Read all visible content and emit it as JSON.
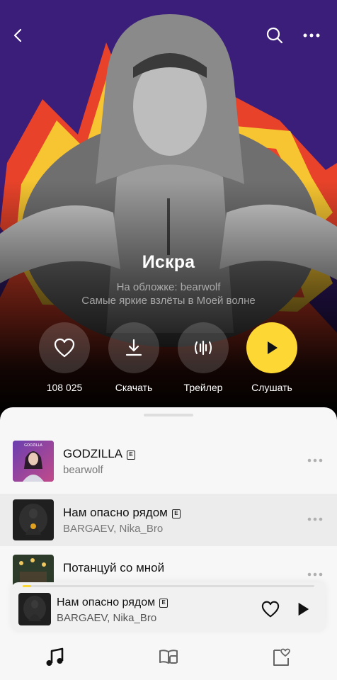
{
  "playlist": {
    "title": "Искра",
    "cover_credit": "На обложке: bearwolf",
    "description": "Самые яркие взлёты в Моей волне"
  },
  "actions": {
    "likes": "108 025",
    "download": "Скачать",
    "trailer": "Трейлер",
    "listen": "Слушать"
  },
  "tracks": [
    {
      "title": "GODZILLA",
      "explicit": true,
      "artist": "bearwolf",
      "cover_label": "GODZILLA"
    },
    {
      "title": "Нам опасно рядом",
      "explicit": true,
      "artist": "BARGAEV, Nika_Bro"
    },
    {
      "title": "Потанцуй со мной",
      "explicit": false,
      "artist": ""
    }
  ],
  "now_playing": {
    "title": "Нам опасно рядом",
    "explicit": true,
    "artist": "BARGAEV, Nika_Bro",
    "progress": 0.03
  },
  "explicit_mark": "E",
  "colors": {
    "hero_purple": "#3b1e7a",
    "accent_yellow": "#fdd835",
    "sheet_bg": "#f7f7f7"
  },
  "tabs": [
    "music-note-icon",
    "podcasts-book-icon",
    "collection-heart-icon"
  ]
}
